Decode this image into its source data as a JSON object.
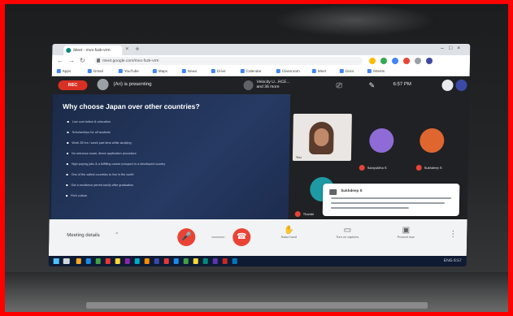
{
  "browser": {
    "tab_label": "Meet - mvs-fxzk-vrm",
    "tab_close": "×",
    "new_tab": "+",
    "window_controls": "–□×",
    "nav": {
      "back": "←",
      "forward": "→",
      "reload": "↻"
    },
    "url": "meet.google.com/mvs-fxzk-vrm",
    "bookmarks": [
      "Apps",
      "Gmail",
      "YouTube",
      "Maps",
      "News",
      "Drive",
      "Calendar",
      "Classroom",
      "Meet",
      "Docs",
      "Sheets"
    ]
  },
  "meet_top": {
    "rec_label": "REC",
    "presenting_text": "(Ari) is presenting",
    "meeting_name_line1": "Velocity U...RCE...",
    "meeting_name_line2": "and 36 more",
    "captions_icon": "⎚",
    "pin_icon": "✎",
    "clock": "6:57 PM"
  },
  "slide": {
    "title": "Why choose Japan over other countries?",
    "bullets": [
      "Low cost tuition & education",
      "Scholarships for all students",
      "Work 28 hrs / week part-time while studying",
      "No entrance exam, direct application procedure",
      "High-paying jobs & a fulfilling career prospect in a developed country",
      "One of the safest countries to live in the world",
      "Get a residence permit easily after graduation",
      "Rich culture"
    ]
  },
  "participants": {
    "self_label": "You",
    "tiles": [
      {
        "name": "Samyuktha S",
        "color": "#8e6bd6"
      },
      {
        "name": "Sukhdeep S",
        "color": "#e0662f"
      },
      {
        "name": "Thambi",
        "color": "#1e9aa5"
      }
    ]
  },
  "chat_popup": {
    "sender": "Sukhdeep S"
  },
  "meet_bottom": {
    "meeting_details": "Meeting details",
    "caret": "^",
    "mic_icon": "🎤",
    "hangup_icon": "☎",
    "present_label": "Raise hand",
    "captions_label": "Turn on captions",
    "present_now_label": "Present now",
    "more_icon": "⋮"
  },
  "taskbar": {
    "tray": "ENG 6:57"
  },
  "colors": {
    "frame": "#ff0000",
    "meet_dark": "#202124",
    "danger": "#ea4335"
  }
}
